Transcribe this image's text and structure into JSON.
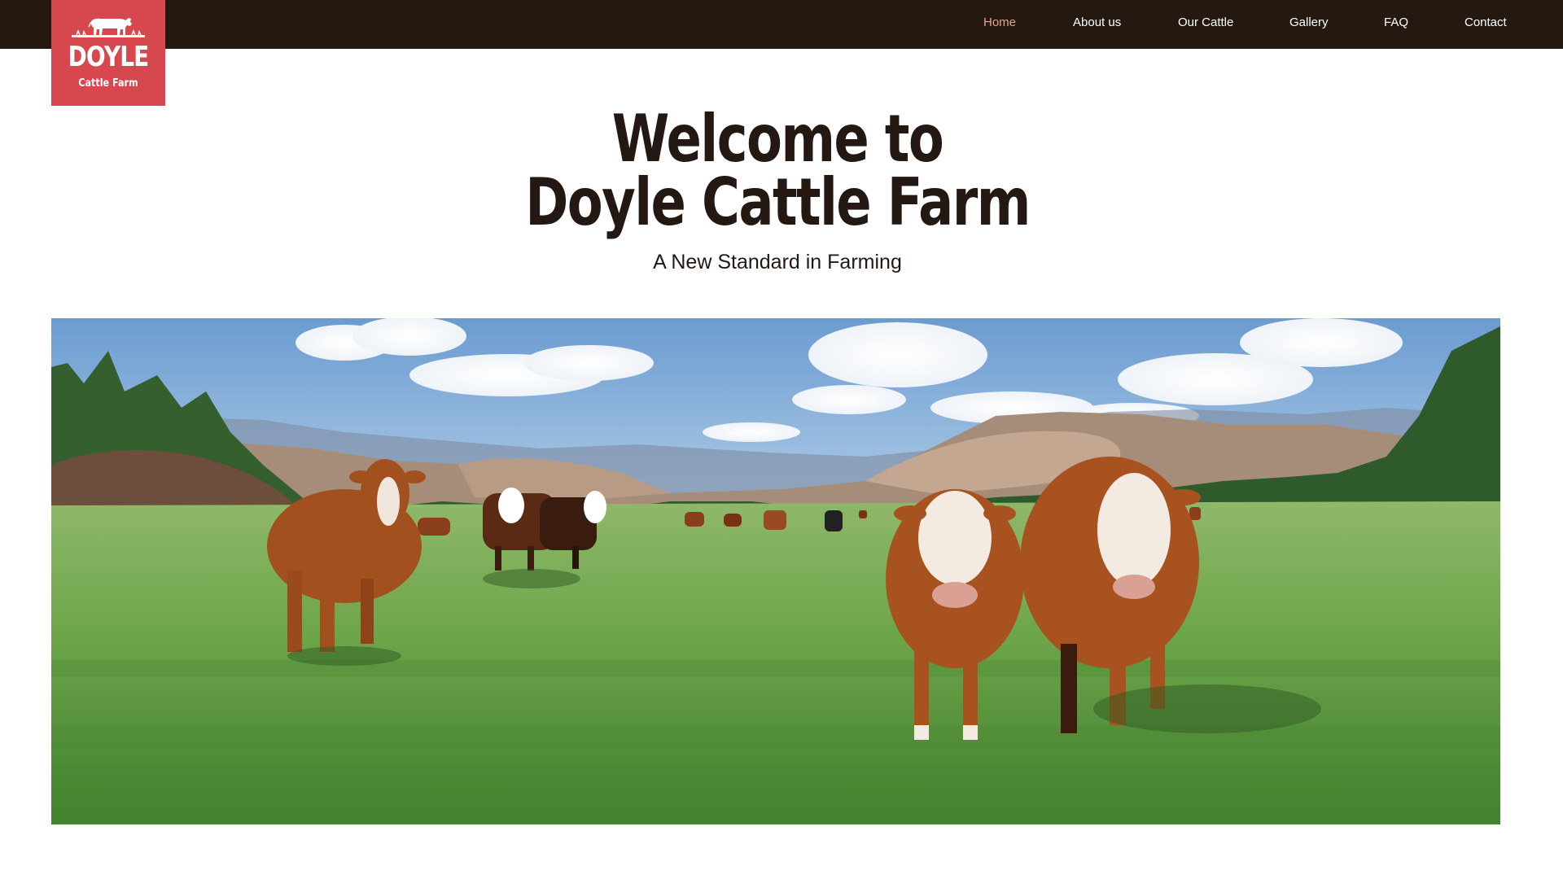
{
  "brand": {
    "name": "DOYLE",
    "tagline": "Cattle Farm",
    "logo_icon": "cow-icon",
    "logo_color": "#d6474e"
  },
  "nav": {
    "items": [
      {
        "label": "Home",
        "active": true
      },
      {
        "label": "About us",
        "active": false
      },
      {
        "label": "Our Cattle",
        "active": false
      },
      {
        "label": "Gallery",
        "active": false
      },
      {
        "label": "FAQ",
        "active": false
      },
      {
        "label": "Contact",
        "active": false
      }
    ],
    "bar_color": "#241810",
    "active_color": "#e8a391"
  },
  "hero": {
    "title_line1": "Welcome to",
    "title_line2": "Doyle Cattle Farm",
    "subtitle": "A New Standard in Farming",
    "image_subject": "herd of cattle grazing in a green pasture with hills and sky"
  }
}
